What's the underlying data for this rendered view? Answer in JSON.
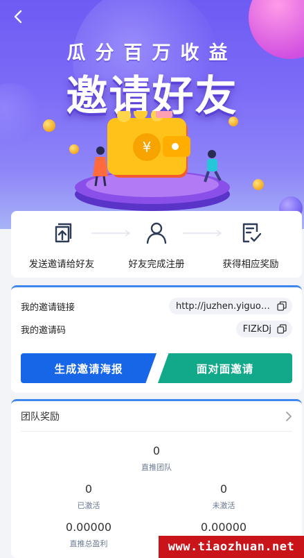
{
  "banner": {
    "slogan": "瓜分百万收益",
    "title": "邀请好友"
  },
  "steps": [
    {
      "label": "发送邀请给好友",
      "icon": "send-invite-icon"
    },
    {
      "label": "好友完成注册",
      "icon": "user-icon"
    },
    {
      "label": "获得相应奖励",
      "icon": "checked-document-icon"
    }
  ],
  "invite": {
    "link_label": "我的邀请链接",
    "link_value": "http://juzhen.yiguoji...",
    "code_label": "我的邀请码",
    "code_value": "FIZkDj",
    "poster_button": "生成邀请海报",
    "face_button": "面对面邀请"
  },
  "team": {
    "title": "团队奖励",
    "direct_team_value": "0",
    "direct_team_label": "直推团队",
    "activated_value": "0",
    "activated_label": "已激活",
    "not_activated_value": "0",
    "not_activated_label": "未激活",
    "total_profit_value": "0.00000",
    "total_profit_label": "直推总盈利",
    "other_value": "0.00000"
  },
  "watermark": "www.tiaozhuan.net",
  "colors": {
    "primary_blue": "#1766e8",
    "teal": "#11a98a",
    "banner_purple": "#6d5bf3"
  }
}
